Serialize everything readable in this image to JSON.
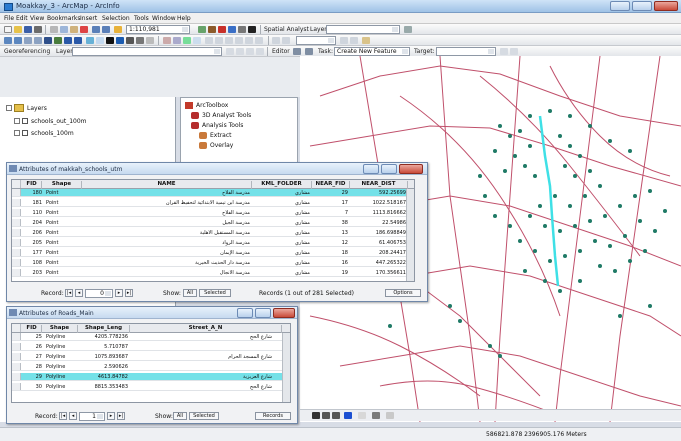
{
  "window": {
    "title": "Moakkay_3 - ArcMap - ArcInfo"
  },
  "menubar": {
    "items": [
      "File",
      "Edit",
      "View",
      "Bookmarks",
      "Insert",
      "Selection",
      "Tools",
      "Window",
      "Help"
    ]
  },
  "toolbar": {
    "scale_value": "1:110,981",
    "spatial_analyst_label": "Spatial Analyst",
    "georeferencing_label": "Georeferencing",
    "layer_label": "Layer:",
    "editor_label": "Editor",
    "task_label": "Task:",
    "task_value": "Create New Feature",
    "target_label": "Target:"
  },
  "toc": {
    "root_label": "Layers",
    "layers": [
      "schools_out_100m",
      "schools_100m"
    ]
  },
  "toolbox": {
    "root_label": "ArcToolbox",
    "items": [
      "3D Analyst Tools",
      "Analysis Tools",
      "Extract",
      "Overlay"
    ]
  },
  "table1": {
    "title": "Attributes of makkah_schools_utm",
    "headers": [
      "FID",
      "Shape",
      "NAME",
      "KML_FOLDER",
      "NEAR_FID",
      "NEAR_DIST"
    ],
    "rows": [
      {
        "fid": "180",
        "shape": "Point",
        "name": "مدرسة الفلاح",
        "folder": "مشاري",
        "near_fid": "29",
        "near_dist": "592.25699",
        "selected": true
      },
      {
        "fid": "181",
        "shape": "Point",
        "name": "مدرسة ابن تيمية الابتدائية لتحفيظ القرآن",
        "folder": "مشاري",
        "near_fid": "17",
        "near_dist": "1022.518167",
        "selected": false
      },
      {
        "fid": "110",
        "shape": "Point",
        "name": "مدرسة الفلاح",
        "folder": "مشاري",
        "near_fid": "7",
        "near_dist": "1113.816662",
        "selected": false
      },
      {
        "fid": "204",
        "shape": "Point",
        "name": "مدرسة الجيل",
        "folder": "مشاري",
        "near_fid": "38",
        "near_dist": "22.54986",
        "selected": false
      },
      {
        "fid": "206",
        "shape": "Point",
        "name": "مدرسة المستقبل الأهلية",
        "folder": "مشاري",
        "near_fid": "13",
        "near_dist": "186.698849",
        "selected": false
      },
      {
        "fid": "205",
        "shape": "Point",
        "name": "مدرسة الرواد",
        "folder": "مشاري",
        "near_fid": "12",
        "near_dist": "61.406753",
        "selected": false
      },
      {
        "fid": "177",
        "shape": "Point",
        "name": "مدرسة الإيمان",
        "folder": "مشاري",
        "near_fid": "18",
        "near_dist": "208.24417",
        "selected": false
      },
      {
        "fid": "108",
        "shape": "Point",
        "name": "مدرسة دار الحديث الخيرية",
        "folder": "مشاري",
        "near_fid": "16",
        "near_dist": "447.265322",
        "selected": false
      },
      {
        "fid": "203",
        "shape": "Point",
        "name": "مدرسة الأنجال",
        "folder": "مشاري",
        "near_fid": "19",
        "near_dist": "170.356611",
        "selected": false
      }
    ],
    "record_label": "Record:",
    "record_value": "0",
    "show_label": "Show:",
    "show_all": "All",
    "show_selected": "Selected",
    "records_status": "Records (1 out of 281 Selected)",
    "options_label": "Options"
  },
  "table2": {
    "title": "Attributes of Roads_Main",
    "headers": [
      "FID",
      "Shape",
      "Shape_Leng",
      "Street_A_N"
    ],
    "rows": [
      {
        "fid": "25",
        "shape": "Polyline",
        "leng": "4205.778236",
        "street": "شارع الحج",
        "selected": false
      },
      {
        "fid": "26",
        "shape": "Polyline",
        "leng": "5.710787",
        "street": "",
        "selected": false
      },
      {
        "fid": "27",
        "shape": "Polyline",
        "leng": "1075.893687",
        "street": "شارع المسجد الحرام",
        "selected": false
      },
      {
        "fid": "28",
        "shape": "Polyline",
        "leng": "2.590626",
        "street": "",
        "selected": false
      },
      {
        "fid": "29",
        "shape": "Polyline",
        "leng": "4613.84782",
        "street": "شارع العزيزية",
        "selected": true
      },
      {
        "fid": "30",
        "shape": "Polyline",
        "leng": "8815.353483",
        "street": "شارع الحج",
        "selected": false
      }
    ],
    "record_label": "Record:",
    "record_value": "1",
    "show_label": "Show:",
    "show_all": "All",
    "show_selected": "Selected",
    "records_label": "Records"
  },
  "statusbar": {
    "coordinates": "586821.878  2396905.176 Meters"
  },
  "colors": {
    "road": "#c0506b",
    "school_point": "#1f7a66",
    "selected_road": "#3fe0e6",
    "selection_row": "#74e1e8"
  }
}
